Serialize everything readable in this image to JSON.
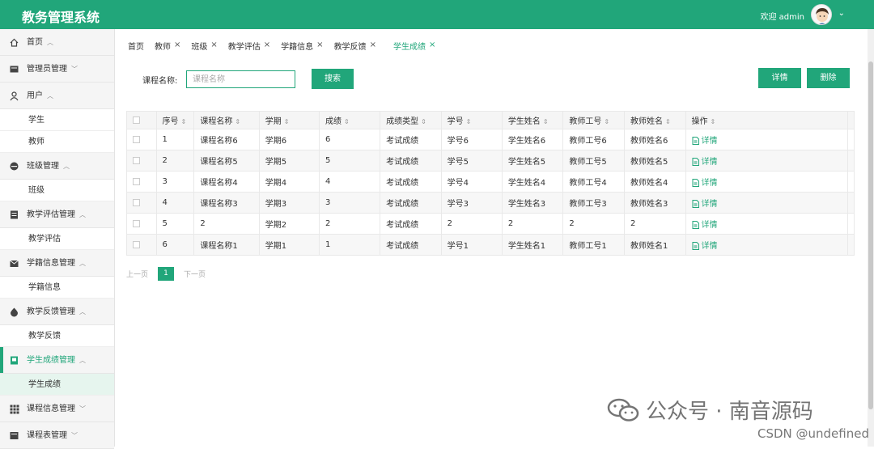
{
  "app": {
    "title": "教务管理系统",
    "welcome": "欢迎 admin"
  },
  "sidebar": {
    "groups": [
      {
        "label": "首页",
        "icon": "home-icon",
        "caret": "^",
        "items": []
      },
      {
        "label": "管理员管理",
        "icon": "admin-icon",
        "caret": "v",
        "items": []
      },
      {
        "label": "用户",
        "icon": "user-icon",
        "caret": "^",
        "items": [
          "学生",
          "教师"
        ]
      },
      {
        "label": "班级管理",
        "icon": "class-icon",
        "caret": "^",
        "items": [
          "班级"
        ]
      },
      {
        "label": "教学评估管理",
        "icon": "evaluation-icon",
        "caret": "^",
        "items": [
          "教学评估"
        ]
      },
      {
        "label": "学籍信息管理",
        "icon": "mail-icon",
        "caret": "^",
        "items": [
          "学籍信息"
        ]
      },
      {
        "label": "教学反馈管理",
        "icon": "feedback-icon",
        "caret": "^",
        "items": [
          "教学反馈"
        ]
      },
      {
        "label": "学生成绩管理",
        "icon": "grade-icon",
        "caret": "^",
        "items": [
          "学生成绩"
        ]
      },
      {
        "label": "课程信息管理",
        "icon": "grid-icon",
        "caret": "v",
        "items": []
      },
      {
        "label": "课程表管理",
        "icon": "schedule-icon",
        "caret": "v",
        "items": []
      }
    ]
  },
  "tabs": [
    {
      "label": "首页",
      "closable": false
    },
    {
      "label": "教师",
      "closable": true
    },
    {
      "label": "班级",
      "closable": true
    },
    {
      "label": "教学评估",
      "closable": true
    },
    {
      "label": "学籍信息",
      "closable": true
    },
    {
      "label": "教学反馈",
      "closable": true
    },
    {
      "label": "学生成绩",
      "closable": true,
      "active": true
    }
  ],
  "search": {
    "label": "课程名称:",
    "placeholder": "课程名称",
    "button": "搜索"
  },
  "actions": {
    "detail": "详情",
    "delete": "删除"
  },
  "table": {
    "headers": [
      "序号",
      "课程名称",
      "学期",
      "成绩",
      "成绩类型",
      "学号",
      "学生姓名",
      "教师工号",
      "教师姓名",
      "操作"
    ],
    "rows": [
      [
        "1",
        "课程名称6",
        "学期6",
        "6",
        "考试成绩",
        "学号6",
        "学生姓名6",
        "教师工号6",
        "教师姓名6"
      ],
      [
        "2",
        "课程名称5",
        "学期5",
        "5",
        "考试成绩",
        "学号5",
        "学生姓名5",
        "教师工号5",
        "教师姓名5"
      ],
      [
        "3",
        "课程名称4",
        "学期4",
        "4",
        "考试成绩",
        "学号4",
        "学生姓名4",
        "教师工号4",
        "教师姓名4"
      ],
      [
        "4",
        "课程名称3",
        "学期3",
        "3",
        "考试成绩",
        "学号3",
        "学生姓名3",
        "教师工号3",
        "教师姓名3"
      ],
      [
        "5",
        "2",
        "学期2",
        "2",
        "考试成绩",
        "2",
        "2",
        "2",
        "2"
      ],
      [
        "6",
        "课程名称1",
        "学期1",
        "1",
        "考试成绩",
        "学号1",
        "学生姓名1",
        "教师工号1",
        "教师姓名1"
      ]
    ],
    "row_action": "详情"
  },
  "pager": {
    "prev": "上一页",
    "current": "1",
    "next": "下一页"
  },
  "watermark": {
    "text": "公众号 · 南音源码",
    "csdn": "CSDN @undefined"
  },
  "colors": {
    "primary": "#21a67a"
  }
}
